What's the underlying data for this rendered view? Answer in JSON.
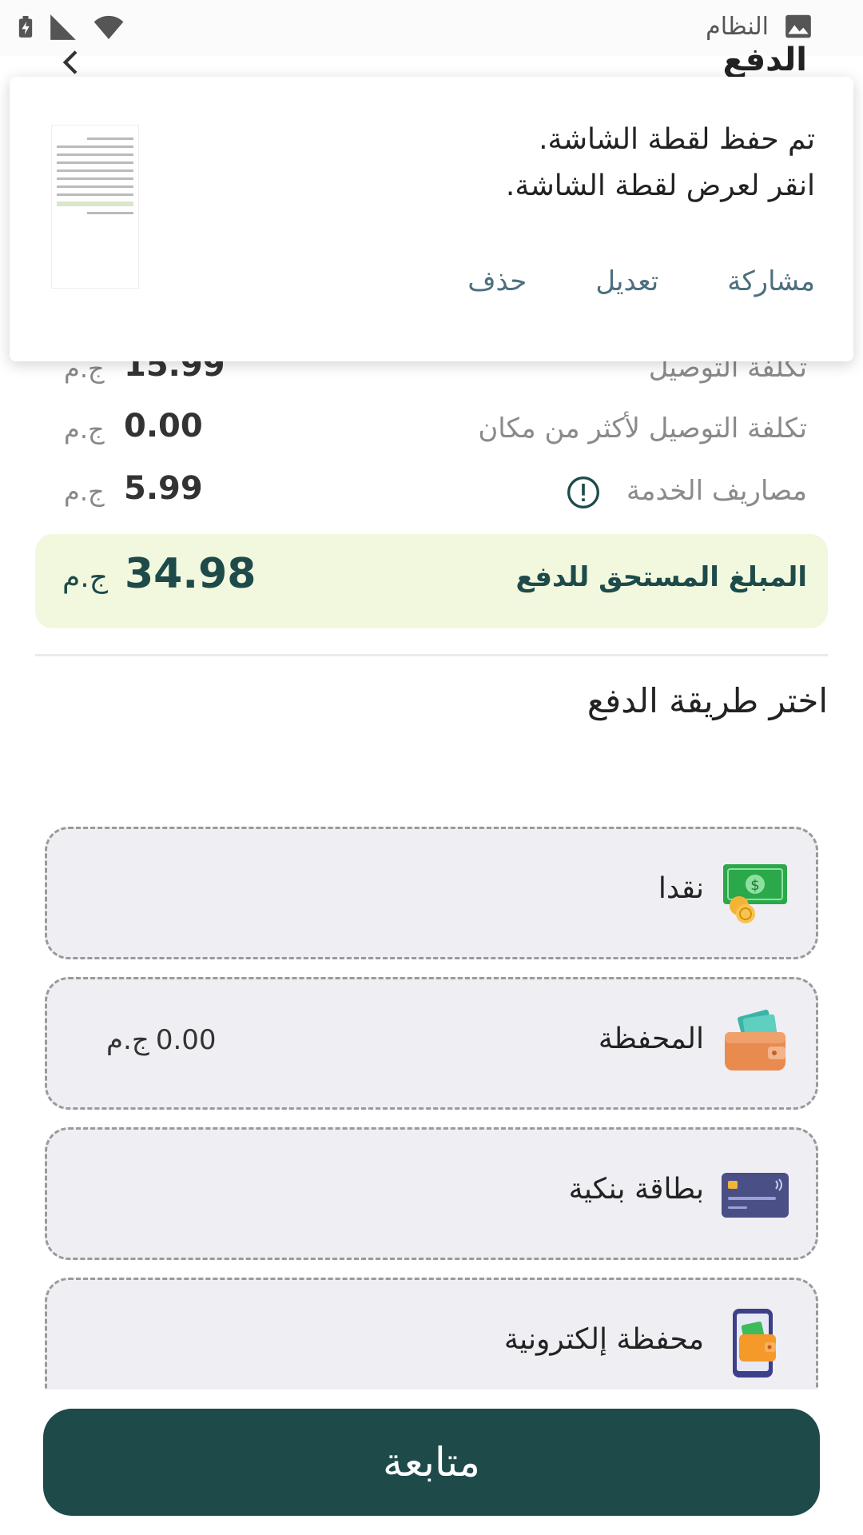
{
  "status_bar": {
    "label": "النظام",
    "icons": [
      "battery-charging-icon",
      "cell-signal-icon",
      "wifi-icon",
      "image-notification-icon"
    ]
  },
  "header": {
    "title": "الدفع"
  },
  "notification": {
    "title": "تم حفظ لقطة الشاشة.",
    "subtitle": "انقر لعرض لقطة الشاشة.",
    "actions": {
      "share": "مشاركة",
      "edit": "تعديل",
      "delete": "حذف"
    }
  },
  "summary": {
    "delivery": {
      "label": "تكلفة التوصيل",
      "value": "15.99",
      "currency": "ج.م"
    },
    "multi_delivery": {
      "label": "تكلفة التوصيل لأكثر من مكان",
      "value": "0.00",
      "currency": "ج.م"
    },
    "service": {
      "label": "مصاريف الخدمة",
      "value": "5.99",
      "currency": "ج.م"
    },
    "total": {
      "label": "المبلغ المستحق للدفع",
      "value": "34.98",
      "currency": "ج.م"
    }
  },
  "payment": {
    "section_title": "اختر طريقة الدفع",
    "options": [
      {
        "label": "نقدا",
        "icon": "cash-icon"
      },
      {
        "label": "المحفظة",
        "icon": "wallet-icon",
        "balance": "0.00",
        "currency": "ج.م"
      },
      {
        "label": "بطاقة بنكية",
        "icon": "credit-card-icon"
      },
      {
        "label": "محفظة إلكترونية",
        "icon": "mobile-wallet-icon"
      }
    ]
  },
  "continue_label": "متابعة",
  "colors": {
    "primary": "#1e4a4a",
    "total_bg": "#f1f8de",
    "option_bg": "#efeef3",
    "action_text": "#4d6f7e"
  }
}
